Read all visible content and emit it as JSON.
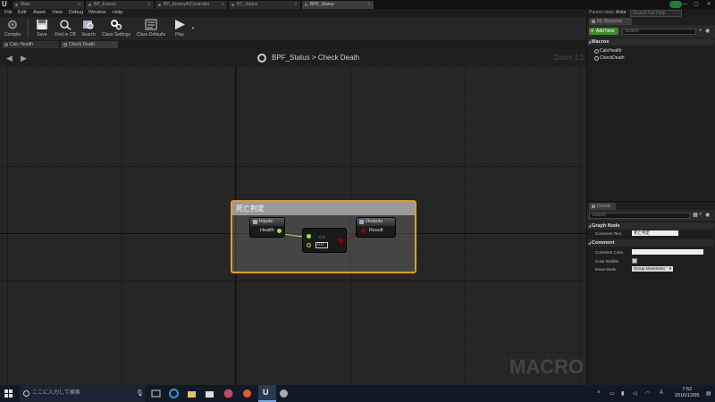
{
  "window": {
    "logo": "U",
    "tabs": [
      "Main",
      "BP_Enemy",
      "BP_EnemyAIController",
      "BT_Status",
      "BPF_Status"
    ],
    "active_tab_index": 4,
    "controls": [
      "—",
      "▢",
      "✕"
    ]
  },
  "menu": {
    "items": [
      "File",
      "Edit",
      "Asset",
      "View",
      "Debug",
      "Window",
      "Help"
    ],
    "parent_class_label": "Parent class:",
    "parent_class_value": "Actor",
    "search_help_placeholder": "Search For Help"
  },
  "toolbar": {
    "compile": "Compile",
    "save": "Save",
    "find_in_cb": "Find in CB",
    "search": "Search",
    "class_settings": "Class Settings",
    "class_defaults": "Class Defaults",
    "play": "Play"
  },
  "function_tabs": [
    "Calc Health",
    "Check Death"
  ],
  "graph": {
    "breadcrumb_root": "BPF_Status",
    "breadcrumb_sep": ">",
    "breadcrumb_current": "Check Death",
    "zoom": "Zoom 1:1",
    "watermark": "MACRO",
    "comment_title": "死亡判定",
    "inputs_node": {
      "title": "Inputs",
      "pin": "Health"
    },
    "outputs_node": {
      "title": "Outputs",
      "pin": "Result"
    },
    "compare_node": {
      "op": "<=",
      "value": "0.0"
    }
  },
  "my_blueprint": {
    "tab_label": "My Blueprint",
    "add_new": "Add New",
    "search_placeholder": "Search",
    "section": "Macros",
    "macros": [
      "CalcHealth",
      "CheckDeath"
    ]
  },
  "details": {
    "tab_label": "Details",
    "search_placeholder": "Search",
    "graph_node_section": "Graph Node",
    "comment_text_label": "Comment Text",
    "comment_text_value": "死亡判定",
    "comment_section": "Comment",
    "comment_color_label": "Comment Color",
    "color_bubble_label": "Color Bubble",
    "move_mode_label": "Move Mode",
    "move_mode_value": "Group Movement"
  },
  "taskbar": {
    "search_placeholder": "ここに入力して検索",
    "time": "7:52",
    "date": "2016/12/05",
    "ime": "A"
  },
  "colors": {
    "comment_border": "#e89b1c",
    "float_pin": "#9ce33a",
    "exec_pin": "#ffffff",
    "bool_pin": "#950000",
    "add_new": "#3f8a2e"
  }
}
